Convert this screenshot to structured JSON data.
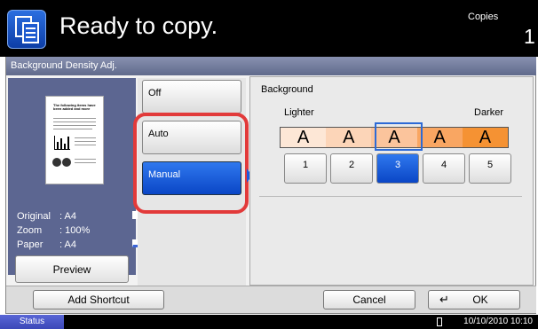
{
  "header": {
    "status_text": "Ready to copy.",
    "copies_label": "Copies",
    "copies_count": "1"
  },
  "panel": {
    "title": "Background Density Adj."
  },
  "preview": {
    "thumbnail_title": "The following items have been added and more",
    "info": [
      {
        "key": "Original",
        "value": ": A4"
      },
      {
        "key": "Zoom",
        "value": ": 100%"
      },
      {
        "key": "Paper",
        "value": ": A4"
      }
    ],
    "button_label": "Preview"
  },
  "options": [
    {
      "label": "Off",
      "selected": false
    },
    {
      "label": "Auto",
      "selected": false
    },
    {
      "label": "Manual",
      "selected": true
    }
  ],
  "background": {
    "title": "Background",
    "lighter_label": "Lighter",
    "darker_label": "Darker",
    "scale_letters": [
      "A",
      "A",
      "A",
      "A",
      "A"
    ],
    "scale_colors": [
      "#fde7d6",
      "#fcd5b8",
      "#fbc49c",
      "#f9a662",
      "#f59233"
    ],
    "levels": [
      "1",
      "2",
      "3",
      "4",
      "5"
    ],
    "selected_level": "3"
  },
  "footer": {
    "add_shortcut": "Add Shortcut",
    "cancel": "Cancel",
    "ok": "OK"
  },
  "statusbar": {
    "status_label": "Status",
    "datetime": "10/10/2010  10:10"
  },
  "colors": {
    "accent": "#1a5adf",
    "highlight_ring": "#e23a3a"
  }
}
